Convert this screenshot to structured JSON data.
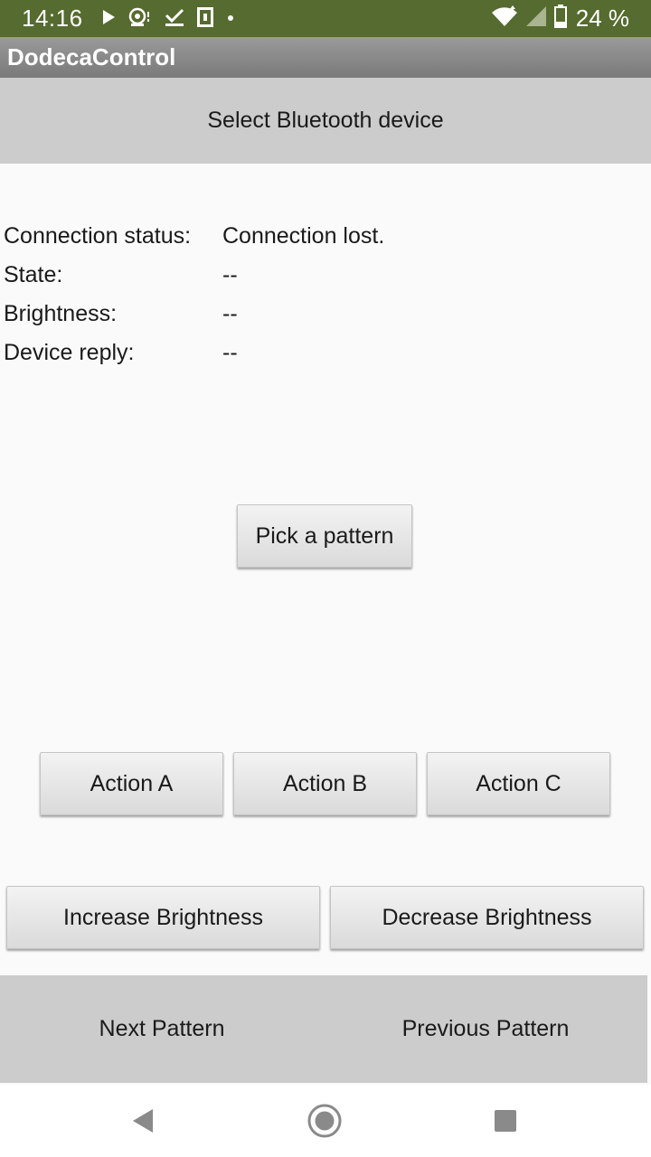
{
  "status_bar": {
    "time": "14:16",
    "battery_percent": "24 %",
    "icons_left": [
      "play-icon",
      "download-icon",
      "check-icon",
      "sim-icon",
      "dot-icon"
    ],
    "icons_right": [
      "wifi-icon",
      "signal-icon",
      "battery-icon"
    ]
  },
  "app": {
    "title": "DodecaControl"
  },
  "bluetooth": {
    "select_label": "Select Bluetooth device"
  },
  "info": {
    "rows": [
      {
        "label": "Connection status:",
        "value": "Connection lost."
      },
      {
        "label": "State:",
        "value": "--"
      },
      {
        "label": "Brightness:",
        "value": "--"
      },
      {
        "label": "Device reply:",
        "value": "--"
      }
    ]
  },
  "pattern": {
    "pick_label": "Pick a pattern",
    "next_label": "Next Pattern",
    "previous_label": "Previous Pattern"
  },
  "actions": {
    "a_label": "Action A",
    "b_label": "Action B",
    "c_label": "Action C"
  },
  "brightness": {
    "increase_label": "Increase Brightness",
    "decrease_label": "Decrease Brightness"
  },
  "nav": {
    "icons": [
      "back-icon",
      "home-icon",
      "recents-icon"
    ]
  },
  "colors": {
    "status_bar": "#556b2f",
    "title_bar": "#8a8a8a",
    "flat_button": "#cccccc",
    "background": "#fafafa"
  }
}
